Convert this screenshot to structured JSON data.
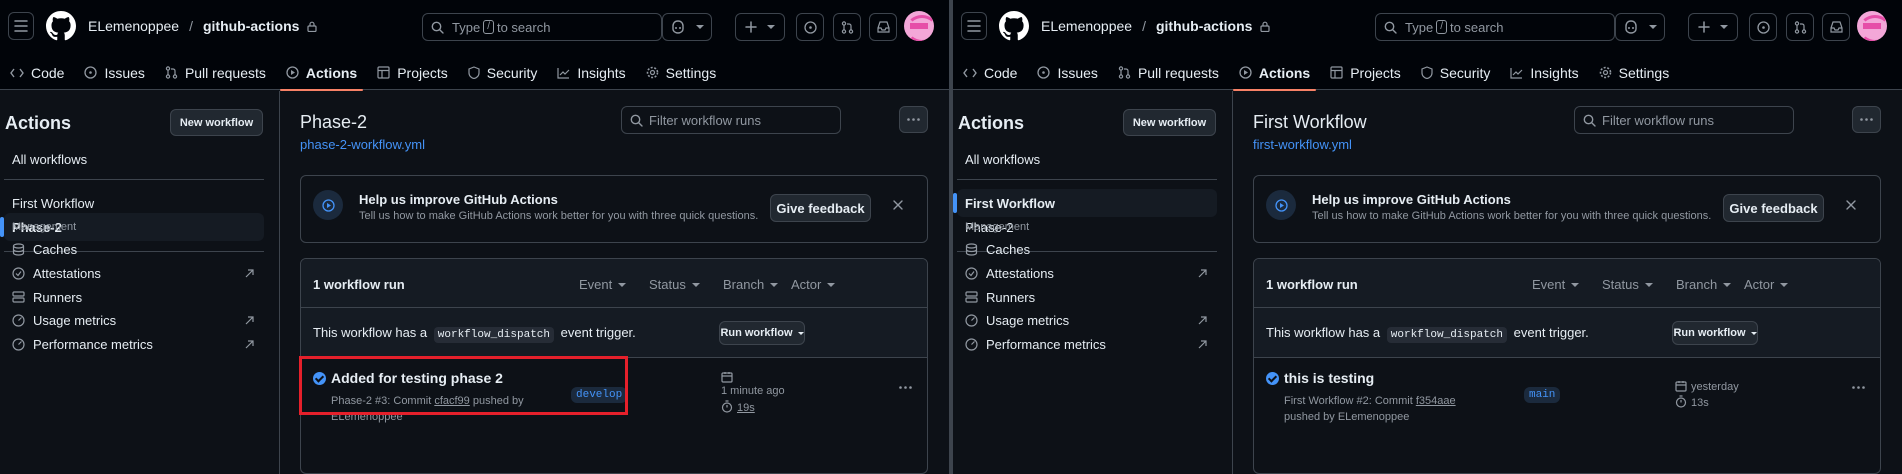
{
  "panes": [
    {
      "owner": "ELemenoppee",
      "separator": "/",
      "repo": "github-actions",
      "search": {
        "prefix": "Type",
        "key": "/",
        "suffix": "to search"
      },
      "tabs": [
        "Code",
        "Issues",
        "Pull requests",
        "Actions",
        "Projects",
        "Security",
        "Insights",
        "Settings"
      ],
      "sidebar": {
        "title": "Actions",
        "new_workflow": "New workflow",
        "all_workflows": "All workflows",
        "workflows": [
          "First Workflow",
          "Phase-2"
        ],
        "management_heading": "Management",
        "management": [
          "Caches",
          "Attestations",
          "Runners",
          "Usage metrics",
          "Performance metrics"
        ]
      },
      "workflow_title": "Phase-2",
      "workflow_file": "phase-2-workflow.yml",
      "filter_placeholder": "Filter workflow runs",
      "banner": {
        "title": "Help us improve GitHub Actions",
        "subtitle": "Tell us how to make GitHub Actions work better for you with three quick questions.",
        "button": "Give feedback"
      },
      "runs_count": "1 workflow run",
      "filters": [
        "Event",
        "Status",
        "Branch",
        "Actor"
      ],
      "dispatch": {
        "prefix": "This workflow has a",
        "code": "workflow_dispatch",
        "suffix": "event trigger."
      },
      "run_workflow": "Run workflow",
      "run": {
        "title": "Added for testing phase 2",
        "meta_prefix": "Phase-2 #3: Commit",
        "commit": "cfacf99",
        "meta_suffix": "pushed by ELemenoppee",
        "branch": "develop",
        "when": "1 minute ago",
        "duration": "19s"
      }
    },
    {
      "owner": "ELemenoppee",
      "separator": "/",
      "repo": "github-actions",
      "search": {
        "prefix": "Type",
        "key": "/",
        "suffix": "to search"
      },
      "tabs": [
        "Code",
        "Issues",
        "Pull requests",
        "Actions",
        "Projects",
        "Security",
        "Insights",
        "Settings"
      ],
      "sidebar": {
        "title": "Actions",
        "new_workflow": "New workflow",
        "all_workflows": "All workflows",
        "workflows": [
          "First Workflow",
          "Phase-2"
        ],
        "management_heading": "Management",
        "management": [
          "Caches",
          "Attestations",
          "Runners",
          "Usage metrics",
          "Performance metrics"
        ]
      },
      "workflow_title": "First Workflow",
      "workflow_file": "first-workflow.yml",
      "filter_placeholder": "Filter workflow runs",
      "banner": {
        "title": "Help us improve GitHub Actions",
        "subtitle": "Tell us how to make GitHub Actions work better for you with three quick questions.",
        "button": "Give feedback"
      },
      "runs_count": "1 workflow run",
      "filters": [
        "Event",
        "Status",
        "Branch",
        "Actor"
      ],
      "dispatch": {
        "prefix": "This workflow has a",
        "code": "workflow_dispatch",
        "suffix": "event trigger."
      },
      "run_workflow": "Run workflow",
      "run": {
        "title": "this is testing",
        "meta_prefix": "First Workflow #2: Commit",
        "commit": "f354aae",
        "meta_suffix": "pushed by ELemenoppee",
        "branch": "main",
        "when": "yesterday",
        "duration": "13s"
      }
    }
  ],
  "colors": {
    "accent": "#4493f8",
    "tab_underline": "#f78166",
    "highlight": "#e5202b",
    "background": "#0d1117"
  },
  "icons": [
    "menu-icon",
    "github-logo-icon",
    "lock-icon",
    "search-icon",
    "copilot-icon",
    "plus-icon",
    "issue-icon",
    "pull-request-icon",
    "inbox-icon",
    "code-icon",
    "play-icon",
    "table-icon",
    "shield-icon",
    "graph-icon",
    "gear-icon",
    "cache-icon",
    "attestation-icon",
    "runner-icon",
    "metrics-icon",
    "external-link-icon",
    "kebab-icon",
    "close-icon",
    "check-circle-icon",
    "calendar-icon",
    "stopwatch-icon"
  ]
}
